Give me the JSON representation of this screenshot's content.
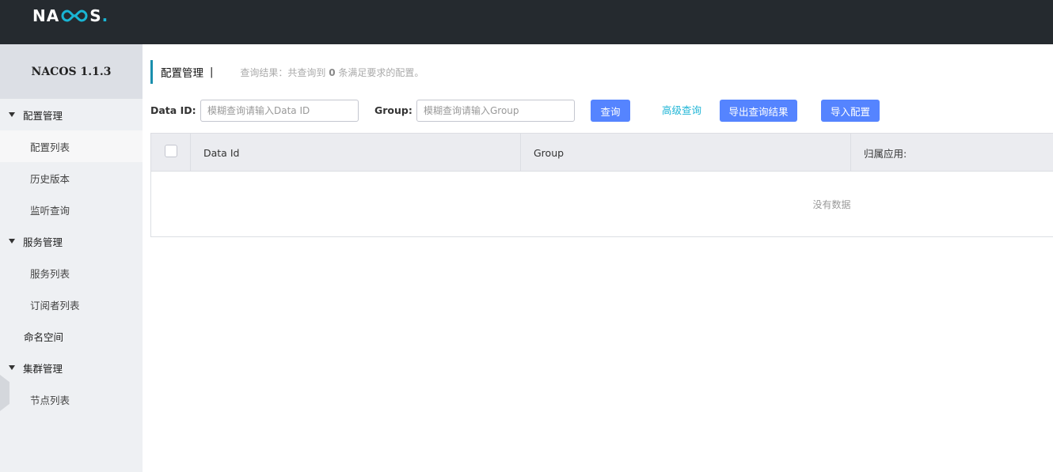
{
  "header": {
    "logo_prefix": "NA",
    "logo_suffix": "S",
    "logo_dot": ".",
    "colors": {
      "bg": "#252a2f",
      "accent": "#19b5d4"
    }
  },
  "sidebar": {
    "version": "NACOS 1.1.3",
    "groups": [
      {
        "label": "配置管理",
        "items": [
          "配置列表",
          "历史版本",
          "监听查询"
        ]
      },
      {
        "label": "服务管理",
        "items": [
          "服务列表",
          "订阅者列表"
        ]
      },
      {
        "label": "命名空间"
      },
      {
        "label": "集群管理",
        "items": [
          "节点列表"
        ]
      }
    ]
  },
  "main": {
    "title": "配置管理",
    "separator": "|",
    "result_prefix": "查询结果：共查询到",
    "result_count": "0",
    "result_suffix": "条满足要求的配置。",
    "search": {
      "data_id_label": "Data ID:",
      "data_id_placeholder": "模糊查询请输入Data ID",
      "group_label": "Group:",
      "group_placeholder": "模糊查询请输入Group",
      "query_button": "查询",
      "advanced_link": "高级查询",
      "export_button": "导出查询结果",
      "import_button": "导入配置"
    },
    "table": {
      "columns": [
        "Data Id",
        "Group",
        "归属应用:"
      ],
      "empty_text": "没有数据"
    }
  },
  "colors": {
    "primary": "#5584ff",
    "link": "#1fb5d6",
    "title_bar": "#1a8fad"
  }
}
